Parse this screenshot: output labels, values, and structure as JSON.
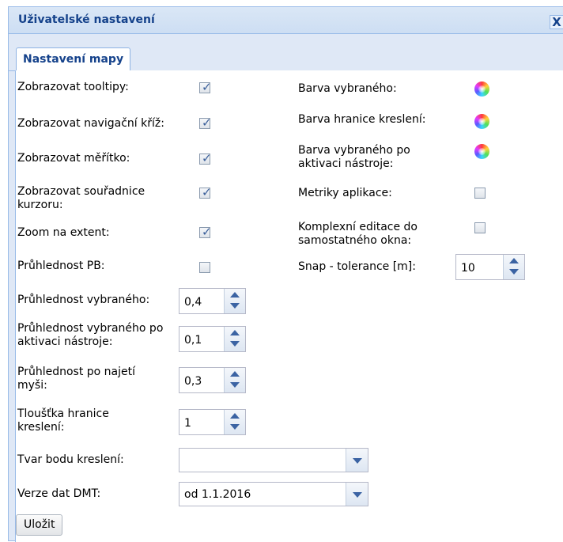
{
  "window": {
    "title": "Uživatelské nastavení",
    "close_label": "X"
  },
  "tabs": [
    {
      "label": "Nastavení mapy"
    }
  ],
  "left": {
    "show_tooltips": {
      "label": "Zobrazovat tooltipy:",
      "checked": true
    },
    "show_nav_cross": {
      "label": "Zobrazovat navigační kříž:",
      "checked": true
    },
    "show_scale": {
      "label": "Zobrazovat měřítko:",
      "checked": true
    },
    "show_cursor_coords": {
      "label": "Zobrazovat souřadnice kurzoru:",
      "checked": true
    },
    "zoom_to_extent": {
      "label": "Zoom na extent:",
      "checked": true
    },
    "transparency_pb": {
      "label": "Průhlednost PB:",
      "checked": false
    },
    "transparency_selected": {
      "label": "Průhlednost vybraného:",
      "value": "0,4"
    },
    "transparency_selected_tool": {
      "label": "Průhlednost vybraného po aktivaci nástroje:",
      "value": "0,1"
    },
    "transparency_hover": {
      "label": "Průhlednost po najetí myši:",
      "value": "0,3"
    },
    "draw_border_width": {
      "label": "Tloušťka hranice kreslení:",
      "value": "1"
    },
    "draw_point_shape": {
      "label": "Tvar bodu kreslení:",
      "value": ""
    },
    "dmt_version": {
      "label": "Verze dat DMT:",
      "value": "od 1.1.2016"
    }
  },
  "right": {
    "selected_color": {
      "label": "Barva vybraného:",
      "icon": "color-picker-icon"
    },
    "draw_border_color": {
      "label": "Barva hranice kreslení:",
      "icon": "color-picker-icon"
    },
    "selected_color_tool": {
      "label": "Barva vybraného po aktivaci nástroje:",
      "icon": "color-picker-icon"
    },
    "app_metrics": {
      "label": "Metriky aplikace:",
      "checked": false
    },
    "complex_editing": {
      "label": "Komplexní editace do samostatného okna:",
      "checked": false
    },
    "snap_tolerance": {
      "label": "Snap - tolerance [m]:",
      "value": "10"
    }
  },
  "save_button": "Uložit"
}
